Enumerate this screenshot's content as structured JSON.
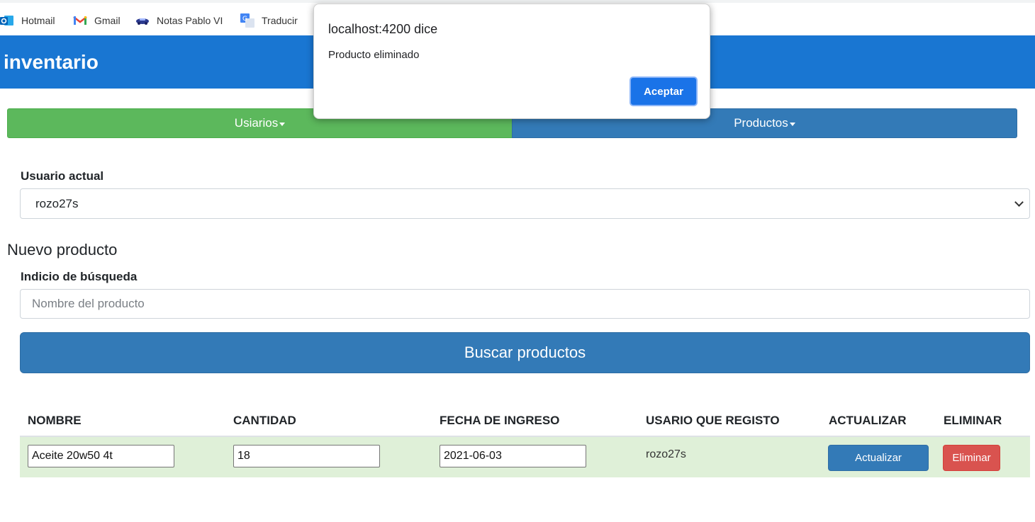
{
  "bookmarks": [
    {
      "label": "Hotmail",
      "icon": "outlook-icon"
    },
    {
      "label": "Gmail",
      "icon": "gmail-icon"
    },
    {
      "label": "Notas Pablo VI",
      "icon": "car-icon"
    },
    {
      "label": "Traducir",
      "icon": "translate-icon"
    }
  ],
  "header": {
    "title": "inventario",
    "color": "#1976d2"
  },
  "nav": {
    "usuarios": "Usiarios",
    "productos": "Productos"
  },
  "form": {
    "user_label": "Usuario actual",
    "user_selected": "rozo27s",
    "section_title": "Nuevo producto",
    "search_label": "Indicio de búsqueda",
    "search_placeholder": "Nombre del producto",
    "search_button": "Buscar productos"
  },
  "table": {
    "headers": [
      "NOMBRE",
      "CANTIDAD",
      "FECHA DE INGRESO",
      "USARIO QUE REGISTO",
      "ACTUALIZAR",
      "ELIMINAR"
    ],
    "rows": [
      {
        "nombre": "Aceite 20w50 4t",
        "cantidad": "18",
        "fecha": "2021-06-03",
        "usuario": "rozo27s",
        "actualizar": "Actualizar",
        "eliminar": "Eliminar"
      }
    ]
  },
  "dialog": {
    "title": "localhost:4200 dice",
    "message": "Producto eliminado",
    "ok": "Aceptar"
  }
}
